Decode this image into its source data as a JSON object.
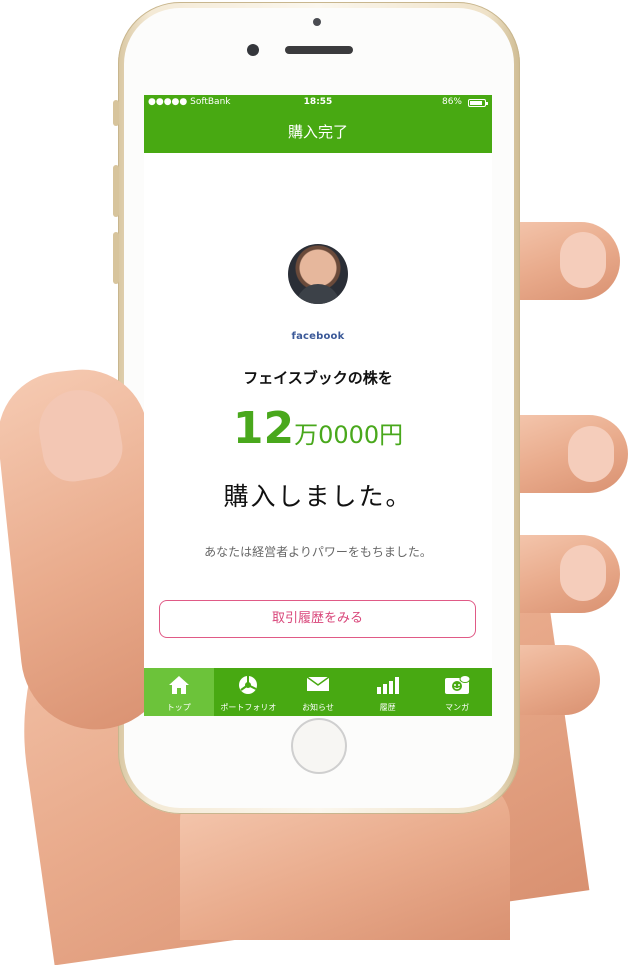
{
  "status_bar": {
    "carrier": "●●●●● SoftBank",
    "time": "18:55",
    "battery": "86%"
  },
  "nav": {
    "title": "購入完了"
  },
  "purchase": {
    "brand": "facebook",
    "stock_line": "フェイスブックの株を",
    "amount_big": "12",
    "amount_man": "万",
    "amount_rest": "0000円",
    "purchased": "購入しました。",
    "message": "あなたは経営者よりパワーをもちました。",
    "history_button": "取引履歴をみる"
  },
  "tabs": [
    {
      "label": "トップ",
      "icon": "home-icon",
      "active": true
    },
    {
      "label": "ポートフォリオ",
      "icon": "pie-chart-icon",
      "active": false
    },
    {
      "label": "お知らせ",
      "icon": "envelope-icon",
      "active": false
    },
    {
      "label": "履歴",
      "icon": "bar-chart-icon",
      "active": false
    },
    {
      "label": "マンガ",
      "icon": "manga-icon",
      "active": false
    }
  ],
  "colors": {
    "accent": "#48a912",
    "amount": "#49a81c",
    "button_border": "#e05a86",
    "brand": "#3b5998"
  }
}
